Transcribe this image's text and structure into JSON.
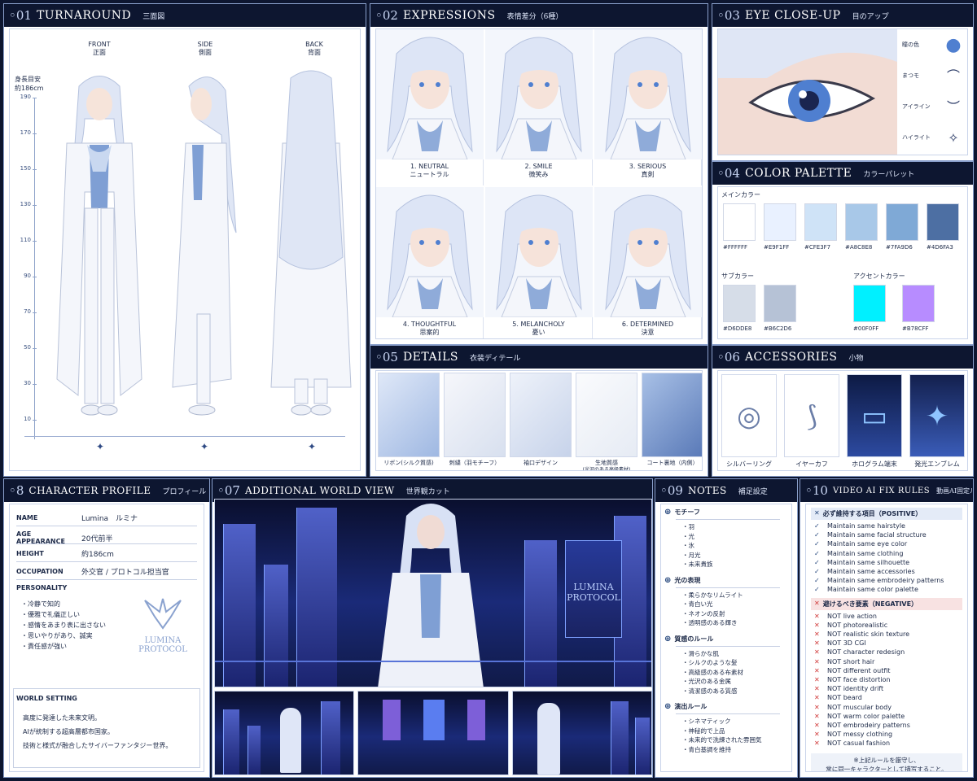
{
  "panels": {
    "turnaround": {
      "num": "◦01",
      "title": "TURNAROUND",
      "sub": "三面図",
      "views": [
        {
          "en": "FRONT",
          "jp": "正面"
        },
        {
          "en": "SIDE",
          "jp": "側面"
        },
        {
          "en": "BACK",
          "jp": "背面"
        }
      ],
      "height_label": "身長目安",
      "height_value": "約186cm",
      "ticks": [
        "190",
        "170",
        "150",
        "130",
        "110",
        "90",
        "70",
        "50",
        "30",
        "10"
      ]
    },
    "expressions": {
      "num": "◦02",
      "title": "EXPRESSIONS",
      "sub": "表情差分（6種）",
      "items": [
        {
          "en": "1. NEUTRAL",
          "jp": "ニュートラル"
        },
        {
          "en": "2. SMILE",
          "jp": "微笑み"
        },
        {
          "en": "3. SERIOUS",
          "jp": "真剣"
        },
        {
          "en": "4. THOUGHTFUL",
          "jp": "思案的"
        },
        {
          "en": "5. MELANCHOLY",
          "jp": "憂い"
        },
        {
          "en": "6. DETERMINED",
          "jp": "決意"
        }
      ]
    },
    "eye": {
      "num": "◦03",
      "title": "EYE CLOSE-UP",
      "sub": "目のアップ",
      "legend": [
        "瞳の色",
        "まつモ",
        "アイライン",
        "ハイライト"
      ]
    },
    "palette": {
      "num": "◦04",
      "title": "COLOR PALETTE",
      "sub": "カラーパレット",
      "main_label": "メインカラー",
      "main": [
        "#FFFFFF",
        "#E9F1FF",
        "#CFE3F7",
        "#A8C8E8",
        "#7FA9D6",
        "#4D6FA3"
      ],
      "sub_label": "サブカラー",
      "subcolors": [
        "#D6DDE8",
        "#B6C2D6"
      ],
      "accent_label": "アクセントカラー",
      "accent": [
        "#00F0FF",
        "#B78CFF"
      ]
    },
    "details": {
      "num": "◦05",
      "title": "DETAILS",
      "sub": "衣装ディテール",
      "items": [
        "リボン(シルク質感)",
        "刺繍（羽モチーフ）",
        "袖口デザイン",
        "生地質感",
        "コート裏地（内側）"
      ],
      "item4_sub": "(光沢のある高級素材)"
    },
    "accessories": {
      "num": "◦06",
      "title": "ACCESSORIES",
      "sub": "小物",
      "items": [
        "シルバーリング",
        "イヤーカフ",
        "ホログラム端末",
        "発光エンブレム"
      ]
    },
    "world": {
      "num": "◦07",
      "title": "ADDITIONAL WORLD VIEW",
      "sub": "世界観カット",
      "sign_line1": "LUMINA",
      "sign_line2": "PROTOCOL"
    },
    "profile": {
      "num": "◦8",
      "title": "CHARACTER PROFILE",
      "sub": "プロフィール",
      "name_k": "NAME",
      "name_v": "Lumina　ルミナ",
      "age_k": "AGE APPEARANCE",
      "age_v": "20代前半",
      "height_k": "HEIGHT",
      "height_v": "約186cm",
      "occ_k": "OCCUPATION",
      "occ_v": "外交官 / プロトコル担当官",
      "personality_k": "PERSONALITY",
      "personality": [
        "・冷静で知的",
        "・優雅で礼儀正しい",
        "・感情をあまり表に出さない",
        "・思いやりがあり、誠実",
        "・責任感が強い"
      ],
      "logo1": "LUMINA",
      "logo2": "PROTOCOL",
      "world_k": "WORLD SETTING",
      "world": [
        "高度に発達した未来文明。",
        "AIが統制する超高層都市国家。",
        "技術と様式が融合したサイバーファンタジー世界。"
      ]
    },
    "notes": {
      "num": "◦09",
      "title": "NOTES",
      "sub": "補足設定",
      "sections": [
        {
          "head": "モチーフ",
          "items": [
            "・羽",
            "・光",
            "・氷",
            "・月光",
            "・未来貴族"
          ]
        },
        {
          "head": "光の表現",
          "items": [
            "・柔らかなリムライト",
            "・青白い光",
            "・ネオンの反射",
            "・透明感のある輝き"
          ]
        },
        {
          "head": "質感のルール",
          "items": [
            "・滑らかな肌",
            "・シルクのような髪",
            "・高級感のある布素材",
            "・光沢のある金属",
            "・清潔感のある質感"
          ]
        },
        {
          "head": "演出ルール",
          "items": [
            "・シネマティック",
            "・神秘的で上品",
            "・未来的で洗練された雰囲気",
            "・青白基調を維持"
          ]
        }
      ]
    },
    "rules": {
      "num": "◦10",
      "title": "VIDEO AI FIX RULES",
      "sub": "動画AI固定ルール",
      "pos_head": "必ず維持する項目（POSITIVE）",
      "positive": [
        "Maintain same hairstyle",
        "Maintain same facial structure",
        "Maintain same eye color",
        "Maintain same clothing",
        "Maintain same silhouette",
        "Maintain same accessories",
        "Maintain same embrodeiry patterns",
        "Maintain same color palette"
      ],
      "neg_head": "避けるべき要素（NEGATIVE）",
      "negative": [
        "NOT live action",
        "NOT photorealistic",
        "NOT realistic skin texture",
        "NOT 3D CGI",
        "NOT character redesign",
        "NOT short hair",
        "NOT different outfit",
        "NOT face distortion",
        "NOT identity drift",
        "NOT beard",
        "NOT muscular body",
        "NOT warm color palette",
        "NOT embrodeiry patterns",
        "NOT messy clothing",
        "NOT casual fashion"
      ],
      "footer1": "※上記ルールを厳守し、",
      "footer2": "常に同一キャラクターとして描写すること。"
    }
  }
}
